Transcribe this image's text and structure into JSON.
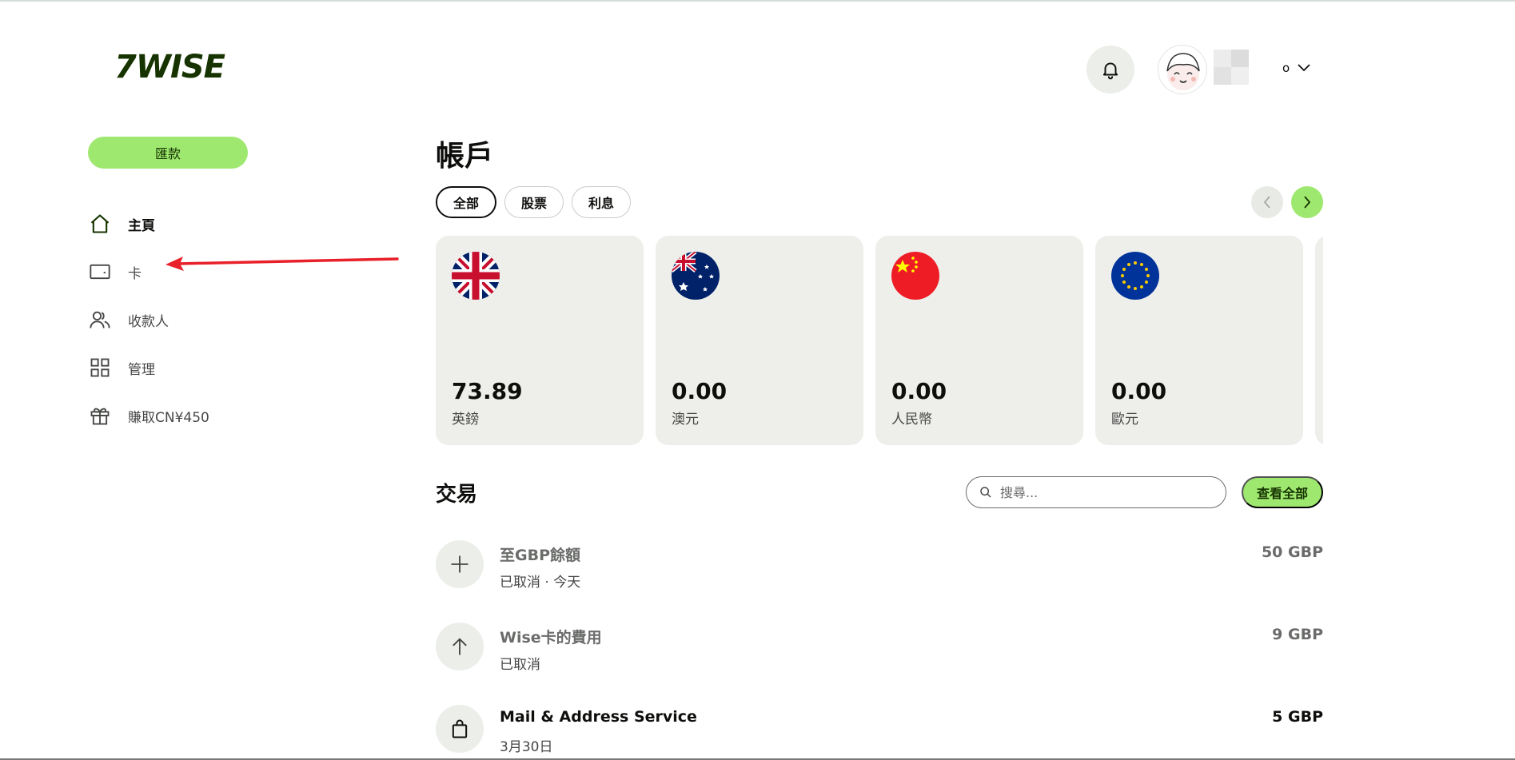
{
  "header": {
    "logo": "7WISE",
    "profile_initial": "o"
  },
  "sidebar": {
    "send_label": "匯款",
    "items": [
      {
        "label": "主頁",
        "icon": "home-icon"
      },
      {
        "label": "卡",
        "icon": "card-icon"
      },
      {
        "label": "收款人",
        "icon": "recipients-icon"
      },
      {
        "label": "管理",
        "icon": "grid-icon"
      },
      {
        "label": "賺取CN¥450",
        "icon": "gift-icon"
      }
    ]
  },
  "main": {
    "title": "帳戶",
    "chips": [
      "全部",
      "股票",
      "利息"
    ],
    "accounts": [
      {
        "amount": "73.89",
        "currency": "英鎊",
        "flag": "uk-flag-icon"
      },
      {
        "amount": "0.00",
        "currency": "澳元",
        "flag": "australia-flag-icon"
      },
      {
        "amount": "0.00",
        "currency": "人民幣",
        "flag": "china-flag-icon"
      },
      {
        "amount": "0.00",
        "currency": "歐元",
        "flag": "eu-flag-icon"
      }
    ],
    "transactions_title": "交易",
    "search_placeholder": "搜尋...",
    "view_all_label": "查看全部",
    "transactions": [
      {
        "name": "至GBP餘額",
        "sub": "已取消 · 今天",
        "amount": "50 GBP",
        "icon": "plus-icon"
      },
      {
        "name": "Wise卡的費用",
        "sub": "已取消",
        "amount": "9 GBP",
        "icon": "arrow-up-icon"
      },
      {
        "name": "Mail & Address Service",
        "sub": "3月30日",
        "amount": "5 GBP",
        "icon": "shopping-bag-icon"
      }
    ]
  },
  "colors": {
    "brand_green": "#9fe870",
    "brand_dark": "#163300",
    "annotation_red": "#e8202a"
  }
}
